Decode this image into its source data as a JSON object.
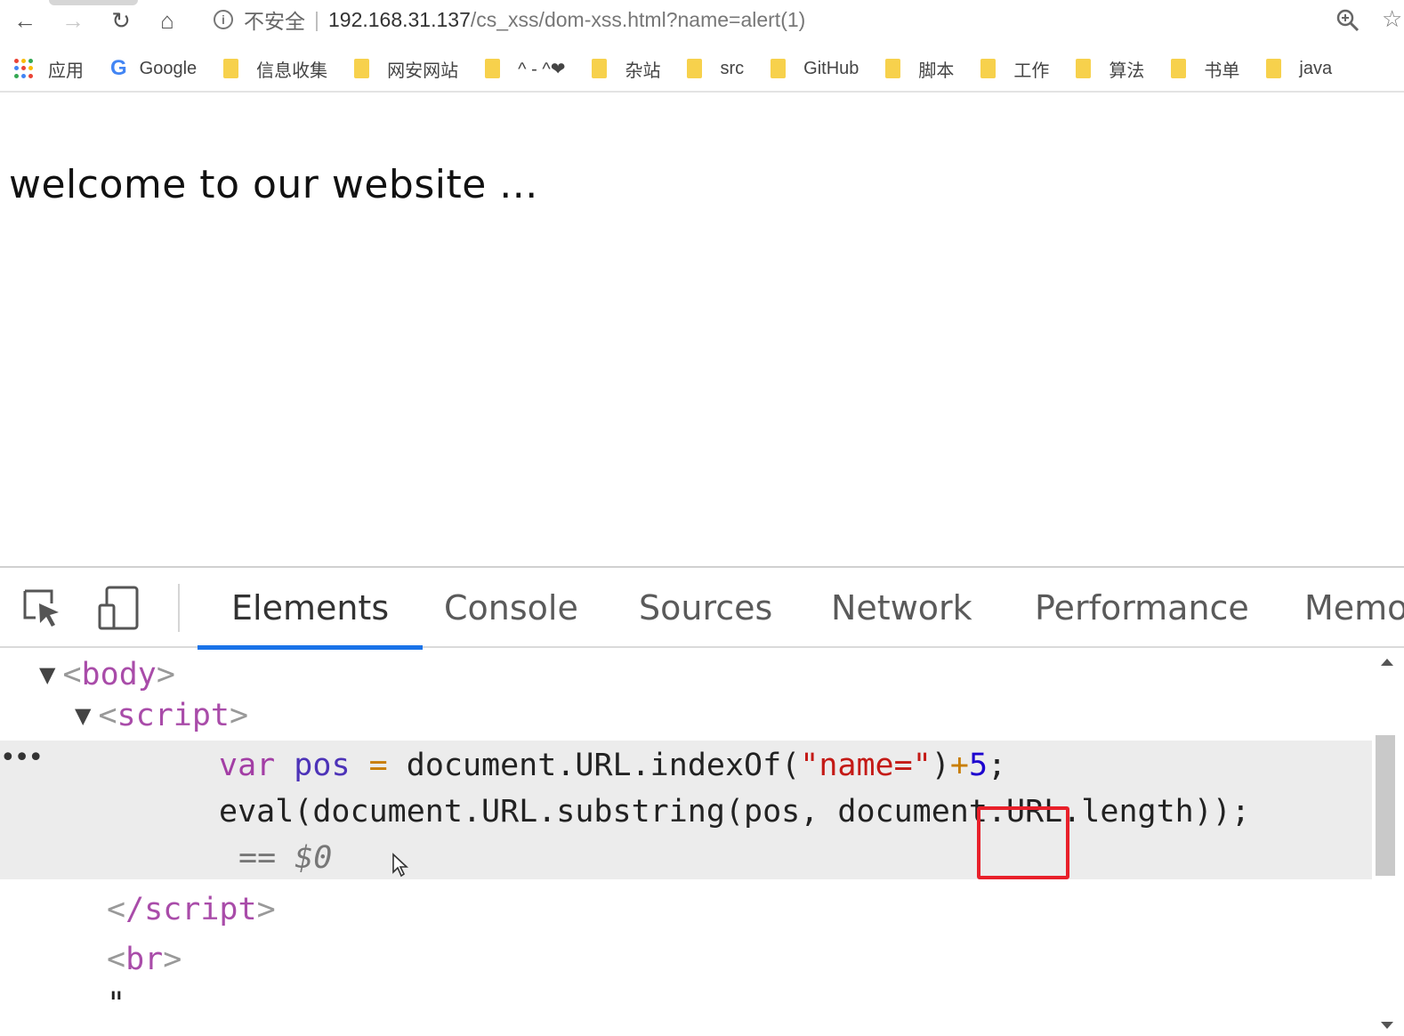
{
  "browser": {
    "back_glyph": "←",
    "forward_glyph": "→",
    "reload_glyph": "↻",
    "home_glyph": "⌂",
    "info_glyph": "i",
    "insecure_label": "不安全",
    "separator": "|",
    "url_host": "192.168.31.137",
    "url_path": "/cs_xss/dom-xss.html?name=alert(1)",
    "star_glyph": "☆"
  },
  "bookmarks": [
    {
      "label": "应用",
      "icon": "apps-grid-icon"
    },
    {
      "label": "Google",
      "icon": "google-icon"
    },
    {
      "label": "信息收集",
      "icon": "folder-icon"
    },
    {
      "label": "网安网站",
      "icon": "folder-icon"
    },
    {
      "label": "^ - ^❤",
      "icon": "folder-icon"
    },
    {
      "label": "杂站",
      "icon": "folder-icon"
    },
    {
      "label": "src",
      "icon": "folder-icon"
    },
    {
      "label": "GitHub",
      "icon": "folder-icon"
    },
    {
      "label": "脚本",
      "icon": "folder-icon"
    },
    {
      "label": "工作",
      "icon": "folder-icon"
    },
    {
      "label": "算法",
      "icon": "folder-icon"
    },
    {
      "label": "书单",
      "icon": "folder-icon"
    },
    {
      "label": "java",
      "icon": "folder-icon"
    }
  ],
  "google_letter": "G",
  "page": {
    "welcome_text": "welcome to our website ..."
  },
  "devtools": {
    "tabs": [
      "Elements",
      "Console",
      "Sources",
      "Network",
      "Performance",
      "Memo"
    ],
    "active_tab": "Elements",
    "tree": {
      "body_tag": "body",
      "script_tag": "script",
      "close_script_tag": "/script",
      "br_tag": "br",
      "quote_text": "\"",
      "line1": {
        "kw": "var",
        "var": "pos",
        "op": "=",
        "expr": "document.URL.indexOf(",
        "str": "\"name=\"",
        "close": ")",
        "plus": "+",
        "num": "5",
        "semi": ";"
      },
      "line2": "eval(document.URL.substring(pos, document.URL.length));",
      "dollar_marker": "== $0",
      "ellipsis": "•••"
    },
    "triangle_glyph": "▼",
    "colors": {
      "active_tab_underline": "#1a73e8",
      "highlight_box": "#e8202a",
      "tag_name": "#a94ca9",
      "string": "#c41a16",
      "number": "#1c00cf"
    }
  }
}
